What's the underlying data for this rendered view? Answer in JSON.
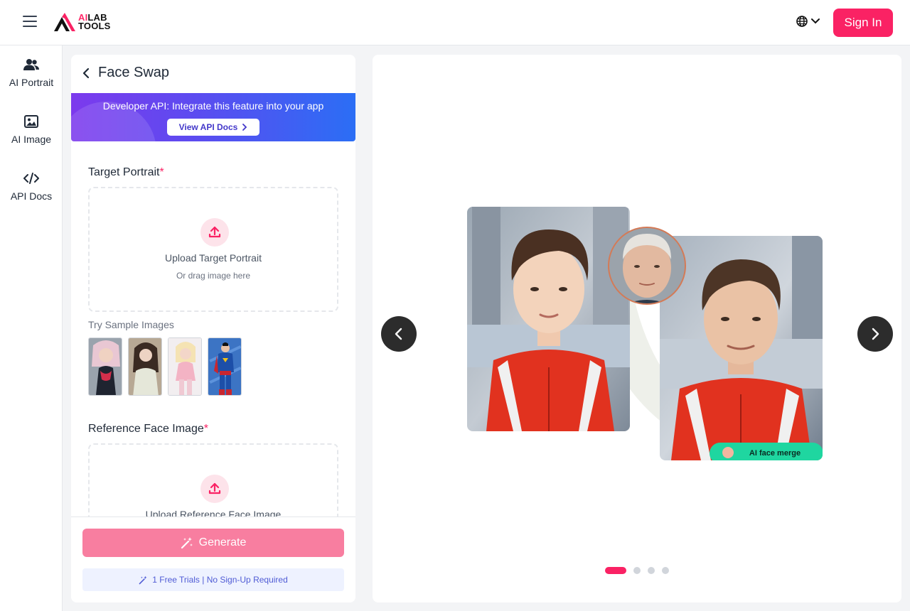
{
  "header": {
    "logo_ai": "AI",
    "logo_lab": "LAB",
    "logo_tools": "TOOLS",
    "signin_label": "Sign In"
  },
  "nav": {
    "items": [
      {
        "label": "AI Portrait",
        "icon": "users-icon"
      },
      {
        "label": "AI Image",
        "icon": "image-icon"
      },
      {
        "label": "API Docs",
        "icon": "code-icon"
      }
    ]
  },
  "panel": {
    "title": "Face Swap",
    "banner": {
      "text": "Developer API: Integrate this feature into your app",
      "button": "View API Docs"
    },
    "target": {
      "label": "Target Portrait",
      "required": "*",
      "upload_title": "Upload Target Portrait",
      "upload_sub": "Or drag image here"
    },
    "try_label": "Try Sample Images",
    "reference": {
      "label": "Reference Face Image",
      "required": "*",
      "upload_title": "Upload Reference Face Image"
    },
    "generate_label": "Generate",
    "trial_text": "1 Free Trials | No Sign-Up Required"
  },
  "preview": {
    "badge_text": "AI face merge",
    "active_slide": 1,
    "slide_count": 4
  },
  "colors": {
    "accent": "#fa2264",
    "generate_disabled": "#f87ea0",
    "banner_start": "#7c3aed",
    "banner_end": "#2b6ef5",
    "badge": "#1fd6a0"
  }
}
